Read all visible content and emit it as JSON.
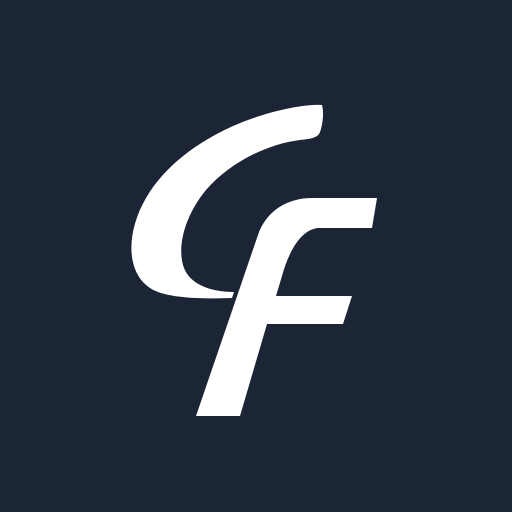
{
  "logo": {
    "letters": "CF",
    "icon": "cf-monogram-icon"
  },
  "colors": {
    "background": "#1c2536",
    "foreground": "#ffffff"
  }
}
